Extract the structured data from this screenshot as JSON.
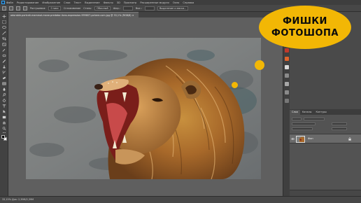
{
  "menu": {
    "items": [
      "Файл",
      "Редактирование",
      "Изображение",
      "Слои",
      "Текст",
      "Выделение",
      "Фильтр",
      "3D",
      "Просмотр",
      "Расширенные модули",
      "Окно",
      "Справка"
    ]
  },
  "options": {
    "feather_label": "Растушевка:",
    "feather_value": "0 пикс",
    "antialias_label": "Сглаживание",
    "style_label": "Стиль:",
    "style_value": "Обычный",
    "width_label": "Шир.:",
    "height_label": "Выс.:",
    "select_mask_label": "Выделение и маска..."
  },
  "document": {
    "tab_title": "adorable-portrait-mammal-mane-predator-lions-expression-999607-pxhere.com.jpg @ 33,1% (RGB/8) ×",
    "status_text": "33,15%    Док: 2,39М/2,39М"
  },
  "panel": {
    "tabs": [
      "Слои",
      "Каналы",
      "Контуры"
    ],
    "layer_name": "Фон"
  },
  "overlay": {
    "line1": "ФИШКИ",
    "line2": "ФОТОШОПА"
  },
  "colors": {
    "accent_yellow": "#f2b705",
    "workspace": "#535353"
  }
}
